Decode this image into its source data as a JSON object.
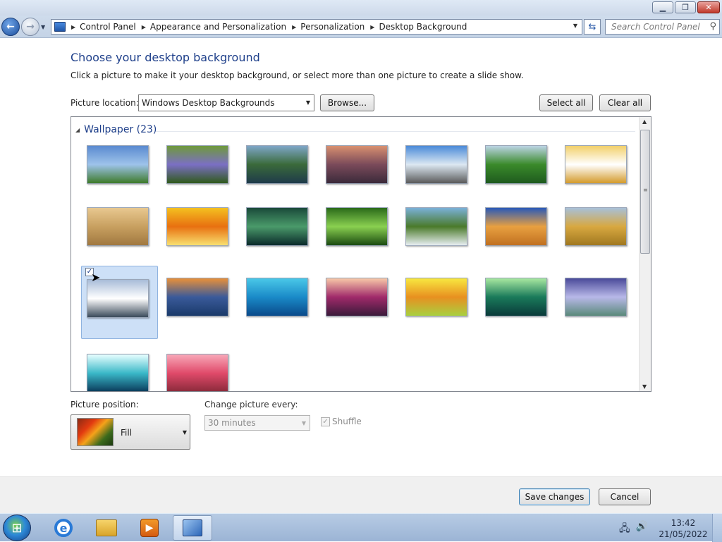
{
  "window": {
    "minimize_icon": "minimize-icon",
    "maximize_icon": "restore-icon",
    "close_icon": "close-icon"
  },
  "address_bar": {
    "breadcrumbs": [
      "Control Panel",
      "Appearance and Personalization",
      "Personalization",
      "Desktop Background"
    ],
    "search_placeholder": "Search Control Panel"
  },
  "page": {
    "title": "Choose your desktop background",
    "subtitle": "Click a picture to make it your desktop background, or select more than one picture to create a slide show."
  },
  "picture_location": {
    "label": "Picture location:",
    "value": "Windows Desktop Backgrounds",
    "browse_label": "Browse...",
    "select_all_label": "Select all",
    "clear_all_label": "Clear all"
  },
  "gallery": {
    "group_title": "Wallpaper (23)",
    "thumbnails": [
      {
        "name": "meadow-stones",
        "colors": [
          "#5a8ad0",
          "#9ec3ea",
          "#3d7a28"
        ]
      },
      {
        "name": "bluebells",
        "colors": [
          "#6e9a3a",
          "#7b6fc4",
          "#2f5a1a"
        ]
      },
      {
        "name": "stone-bridge",
        "colors": [
          "#7ea6c8",
          "#3a6a3a",
          "#1e3a4a"
        ]
      },
      {
        "name": "rocky-shore-sunset",
        "colors": [
          "#d89070",
          "#7a4a5a",
          "#3a2a3a"
        ]
      },
      {
        "name": "dolmen",
        "colors": [
          "#4a8ad8",
          "#dce8f2",
          "#5a5a5a"
        ]
      },
      {
        "name": "green-hills",
        "colors": [
          "#bcd4e4",
          "#3a8a2a",
          "#1e5a1e"
        ]
      },
      {
        "name": "frangipani",
        "colors": [
          "#f2d06a",
          "#ffffff",
          "#d49a2a"
        ]
      },
      {
        "name": "honeycomb-texture",
        "colors": [
          "#e8c890",
          "#c8a060",
          "#a07840"
        ]
      },
      {
        "name": "orange-flower",
        "colors": [
          "#f4c020",
          "#e87010",
          "#f8e070"
        ]
      },
      {
        "name": "green-leaves",
        "colors": [
          "#1a4a3a",
          "#4a9a6a",
          "#0a2a2a"
        ]
      },
      {
        "name": "fern",
        "colors": [
          "#2a6a1a",
          "#8ad050",
          "#1a4a10"
        ]
      },
      {
        "name": "waterfall",
        "colors": [
          "#7ab0d8",
          "#4a7a2a",
          "#e8eef2"
        ]
      },
      {
        "name": "sand-dune",
        "colors": [
          "#2a5ab8",
          "#e8a040",
          "#c07020"
        ]
      },
      {
        "name": "wheat-field",
        "colors": [
          "#a8c0d8",
          "#d8a840",
          "#a07820"
        ]
      },
      {
        "name": "snowy-mountains",
        "colors": [
          "#a8bcd8",
          "#ffffff",
          "#3a4a5a"
        ]
      },
      {
        "name": "mountain-lake",
        "colors": [
          "#e8903a",
          "#3a5a9a",
          "#1a3a6a"
        ]
      },
      {
        "name": "underwater-fish",
        "colors": [
          "#4ac8e8",
          "#1a8ac8",
          "#0a4a8a"
        ]
      },
      {
        "name": "pink-bokeh",
        "colors": [
          "#f8c8a8",
          "#a02a6a",
          "#3a1a3a"
        ]
      },
      {
        "name": "yellow-bokeh",
        "colors": [
          "#f8e840",
          "#e89020",
          "#a8d040"
        ]
      },
      {
        "name": "green-light",
        "colors": [
          "#a8e8a0",
          "#1a7a5a",
          "#0a3a3a"
        ]
      },
      {
        "name": "purple-stripes",
        "colors": [
          "#4a4a9a",
          "#b8b8e8",
          "#5a8a7a"
        ]
      },
      {
        "name": "teal-rays",
        "colors": [
          "#e8ffff",
          "#3ab8c8",
          "#0a3a5a"
        ]
      },
      {
        "name": "pink-dahlia",
        "colors": [
          "#f8a8b8",
          "#e04a6a",
          "#8a2a3a"
        ]
      }
    ],
    "selected_index": 14,
    "selected_checkbox": "✓"
  },
  "position": {
    "label": "Picture position:",
    "value": "Fill"
  },
  "interval": {
    "label": "Change picture every:",
    "value": "30 minutes"
  },
  "shuffle": {
    "label": "Shuffle",
    "checked": true,
    "check_mark": "✓"
  },
  "footer": {
    "save_label": "Save changes",
    "cancel_label": "Cancel"
  },
  "taskbar": {
    "time": "13:42",
    "date": "21/05/2022"
  }
}
